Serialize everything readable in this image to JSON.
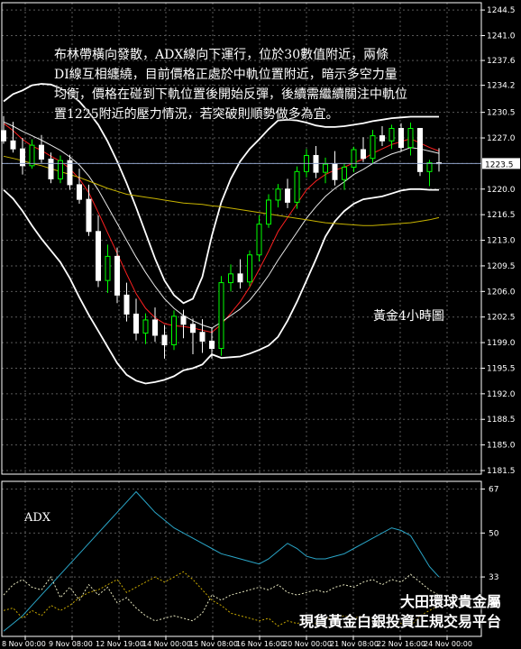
{
  "commentary": {
    "line1": "布林帶橫向發散，ADX線向下運行，位於30數值附近，兩條",
    "line2": "DI線互相纏繞，目前價格正處於中軌位置附近，暗示多空力量",
    "line3": "均衡，價格在碰到下軌位置後開始反彈，後續需繼續關注中軌位",
    "line4": "置1225附近的壓力情況，若突破則順勢做多為宜。"
  },
  "chart_title": "黃金4小時圖",
  "adx_label": "ADX",
  "brand": {
    "line1": "大田環球貴金屬",
    "line2": "現貨黃金白銀投資正規交易平台"
  },
  "colors": {
    "background": "#000000",
    "grid": "#5a5a5a",
    "axis_text": "#ffffff",
    "bull_candle": "#00ff00",
    "bear_candle": "#ffffff",
    "bollinger": "#ffffff",
    "ma_fast": "#ff2020",
    "ma_mid": "#e8e8e8",
    "ma_slow": "#c8b400",
    "current_price_line": "#8fa3c8",
    "adx_line": "#2aa6c8",
    "plus_di_line": "#e8e8c0",
    "minus_di_line": "#c8a800"
  },
  "chart_data": [
    {
      "type": "candlestick",
      "title": "黃金4小時圖",
      "ylim": [
        1181.5,
        1245.5
      ],
      "y_ticks": [
        1244.5,
        1241.0,
        1237.6,
        1234.2,
        1230.5,
        1227.0,
        1223.5,
        1220.0,
        1216.5,
        1213.0,
        1209.5,
        1206.0,
        1202.5,
        1199.0,
        1195.5,
        1192.0,
        1188.5,
        1185.0,
        1181.5
      ],
      "x_ticks": [
        "8 Nov 00:00",
        "9 Nov 08:00",
        "12 Nov 19:00",
        "14 Nov 00:00",
        "15 Nov 08:00",
        "16 Nov 16:00",
        "20 Nov 00:00",
        "21 Nov 08:00",
        "22 Nov 16:00",
        "24 Nov 00:00"
      ],
      "current_price": 1223.5,
      "candles": [
        [
          1228.0,
          1230.0,
          1226.2,
          1226.6
        ],
        [
          1226.6,
          1229.2,
          1225.0,
          1225.5
        ],
        [
          1225.5,
          1227.0,
          1222.0,
          1223.2
        ],
        [
          1223.2,
          1226.8,
          1222.8,
          1226.0
        ],
        [
          1226.0,
          1227.4,
          1223.6,
          1224.1
        ],
        [
          1224.1,
          1225.0,
          1220.8,
          1221.4
        ],
        [
          1221.4,
          1224.6,
          1220.8,
          1223.9
        ],
        [
          1223.9,
          1224.7,
          1219.9,
          1220.6
        ],
        [
          1220.6,
          1222.8,
          1218.0,
          1218.6
        ],
        [
          1218.6,
          1220.6,
          1213.6,
          1214.2
        ],
        [
          1214.2,
          1216.4,
          1206.6,
          1207.5
        ],
        [
          1207.5,
          1212.4,
          1205.8,
          1210.8
        ],
        [
          1210.8,
          1212.0,
          1204.4,
          1205.5
        ],
        [
          1205.5,
          1207.2,
          1201.9,
          1202.9
        ],
        [
          1202.9,
          1205.0,
          1199.3,
          1200.3
        ],
        [
          1200.3,
          1203.0,
          1198.8,
          1202.1
        ],
        [
          1202.1,
          1203.8,
          1199.1,
          1200.0
        ],
        [
          1200.0,
          1201.4,
          1196.8,
          1198.7
        ],
        [
          1198.7,
          1203.4,
          1198.0,
          1202.6
        ],
        [
          1202.6,
          1203.5,
          1199.6,
          1201.5
        ],
        [
          1201.5,
          1202.3,
          1197.4,
          1200.4
        ],
        [
          1200.4,
          1202.2,
          1197.6,
          1199.2
        ],
        [
          1199.2,
          1201.0,
          1196.8,
          1198.2
        ],
        [
          1198.2,
          1208.1,
          1197.2,
          1207.2
        ],
        [
          1207.2,
          1209.7,
          1206.0,
          1208.4
        ],
        [
          1208.4,
          1210.4,
          1206.4,
          1207.3
        ],
        [
          1207.3,
          1211.6,
          1206.7,
          1211.0
        ],
        [
          1211.0,
          1216.4,
          1210.1,
          1215.2
        ],
        [
          1215.2,
          1219.3,
          1214.7,
          1218.5
        ],
        [
          1218.5,
          1220.7,
          1217.5,
          1220.0
        ],
        [
          1220.0,
          1221.4,
          1217.4,
          1218.2
        ],
        [
          1218.2,
          1223.1,
          1217.3,
          1222.4
        ],
        [
          1222.4,
          1225.5,
          1221.6,
          1224.6
        ],
        [
          1224.6,
          1225.9,
          1221.5,
          1222.3
        ],
        [
          1222.3,
          1224.3,
          1220.8,
          1223.4
        ],
        [
          1223.4,
          1225.2,
          1220.5,
          1221.3
        ],
        [
          1221.3,
          1223.5,
          1219.9,
          1223.0
        ],
        [
          1223.0,
          1225.8,
          1222.3,
          1225.4
        ],
        [
          1225.4,
          1227.1,
          1223.7,
          1224.2
        ],
        [
          1224.2,
          1228.1,
          1223.5,
          1227.3
        ],
        [
          1227.3,
          1228.6,
          1225.9,
          1226.6
        ],
        [
          1226.6,
          1228.8,
          1225.5,
          1228.3
        ],
        [
          1228.3,
          1229.0,
          1225.1,
          1225.7
        ],
        [
          1225.7,
          1229.1,
          1224.6,
          1228.3
        ],
        [
          1228.3,
          1227.8,
          1221.8,
          1222.4
        ],
        [
          1222.4,
          1224.0,
          1220.4,
          1223.6
        ],
        [
          1223.6,
          1225.6,
          1222.4,
          1223.5
        ]
      ],
      "bollinger": {
        "upper": [
          1232.0,
          1233.0,
          1233.5,
          1234.2,
          1234.4,
          1234.3,
          1233.8,
          1233.0,
          1232.0,
          1230.5,
          1228.8,
          1226.5,
          1223.8,
          1220.8,
          1217.5,
          1214.0,
          1210.5,
          1207.5,
          1205.5,
          1204.4,
          1205.0,
          1208.0,
          1213.6,
          1218.2,
          1221.4,
          1223.8,
          1225.5,
          1226.8,
          1228.2,
          1229.4,
          1229.5,
          1229.4,
          1229.1,
          1228.7,
          1228.5,
          1228.5,
          1228.6,
          1228.8,
          1229.0,
          1229.3,
          1229.5,
          1229.7,
          1229.8,
          1229.9,
          1229.9,
          1229.9,
          1229.9
        ],
        "lower": [
          1219.9,
          1218.7,
          1217.0,
          1215.0,
          1213.2,
          1211.6,
          1210.0,
          1207.8,
          1205.2,
          1202.8,
          1200.6,
          1198.4,
          1196.2,
          1194.6,
          1193.8,
          1193.4,
          1193.6,
          1193.9,
          1194.4,
          1195.2,
          1195.5,
          1196.0,
          1197.4,
          1196.9,
          1197.0,
          1197.1,
          1197.5,
          1198.0,
          1198.6,
          1199.8,
          1202.0,
          1204.6,
          1207.5,
          1210.4,
          1213.5,
          1215.6,
          1217.0,
          1218.0,
          1218.6,
          1218.8,
          1219.0,
          1219.4,
          1219.8,
          1220.0,
          1220.0,
          1219.9,
          1219.9
        ]
      },
      "moving_averages": [
        {
          "values": [
            1229.0,
            1228.0,
            1226.8,
            1225.9,
            1225.3,
            1224.5,
            1223.8,
            1222.8,
            1221.4,
            1219.5,
            1216.8,
            1214.0,
            1211.2,
            1208.4,
            1205.7,
            1203.7,
            1202.4,
            1201.6,
            1201.3,
            1201.2,
            1201.0,
            1200.7,
            1200.4,
            1201.5,
            1203.0,
            1204.6,
            1206.6,
            1209.0,
            1211.5,
            1214.2,
            1216.1,
            1218.0,
            1219.9,
            1221.1,
            1222.0,
            1222.6,
            1223.0,
            1223.6,
            1224.1,
            1224.9,
            1225.5,
            1226.1,
            1226.5,
            1226.9,
            1226.3,
            1225.7,
            1225.2
          ]
        },
        {
          "values": [
            1229.2,
            1228.6,
            1227.9,
            1227.3,
            1226.7,
            1226.0,
            1225.3,
            1224.4,
            1223.3,
            1221.8,
            1219.9,
            1217.6,
            1215.3,
            1213.0,
            1210.7,
            1208.6,
            1206.7,
            1205.0,
            1203.7,
            1202.7,
            1202.0,
            1201.4,
            1201.0,
            1201.8,
            1202.7,
            1203.6,
            1204.8,
            1206.4,
            1208.2,
            1210.3,
            1212.2,
            1214.1,
            1216.0,
            1217.6,
            1219.0,
            1220.1,
            1221.0,
            1222.0,
            1222.7,
            1223.5,
            1224.2,
            1224.8,
            1225.2,
            1225.7,
            1225.5,
            1225.2,
            1224.9
          ]
        },
        {
          "values": [
            1224.5,
            1224.2,
            1223.9,
            1223.5,
            1223.2,
            1222.8,
            1222.4,
            1222.0,
            1221.6,
            1221.1,
            1220.6,
            1220.1,
            1219.7,
            1219.3,
            1219.1,
            1218.9,
            1218.7,
            1218.5,
            1218.3,
            1218.1,
            1218.0,
            1217.9,
            1217.7,
            1217.6,
            1217.4,
            1217.2,
            1217.0,
            1216.8,
            1216.6,
            1216.4,
            1216.2,
            1216.0,
            1215.8,
            1215.6,
            1215.4,
            1215.3,
            1215.2,
            1215.1,
            1215.0,
            1215.0,
            1215.1,
            1215.2,
            1215.3,
            1215.4,
            1215.6,
            1215.8,
            1216.1
          ]
        }
      ]
    },
    {
      "type": "line",
      "title": "ADX",
      "ylim": [
        10,
        70
      ],
      "y_ticks": [
        67,
        50,
        33
      ],
      "series": [
        {
          "name": "ADX",
          "values": [
            12,
            15,
            18,
            22,
            26,
            30,
            34,
            38,
            42,
            46,
            50,
            54,
            58,
            62,
            66,
            62,
            58,
            55,
            52,
            50,
            48,
            46,
            44,
            42,
            41,
            40,
            39,
            38,
            40,
            43,
            46,
            44,
            41,
            40,
            40,
            41,
            42,
            44,
            46,
            48,
            50,
            52,
            51,
            49,
            43,
            37,
            33
          ]
        },
        {
          "values": [
            26,
            30,
            32,
            29,
            28,
            33,
            25,
            29,
            24,
            30,
            26,
            29,
            23,
            25,
            21,
            18,
            16,
            17,
            18,
            17,
            16,
            19,
            26,
            24,
            26,
            27,
            28,
            29,
            28,
            30,
            27,
            26,
            27,
            28,
            27,
            29,
            30,
            29,
            31,
            32,
            30,
            32,
            31,
            34,
            31,
            28,
            26
          ]
        },
        {
          "values": [
            20,
            21,
            17,
            20,
            18,
            22,
            20,
            22,
            25,
            27,
            28,
            30,
            32,
            27,
            29,
            31,
            33,
            31,
            33,
            35,
            32,
            28,
            24,
            22,
            19,
            18,
            17,
            16,
            17,
            14,
            16,
            15,
            16,
            15,
            17,
            17,
            18,
            17,
            18,
            16,
            15,
            16,
            15,
            14,
            18,
            20,
            22
          ]
        }
      ]
    }
  ]
}
